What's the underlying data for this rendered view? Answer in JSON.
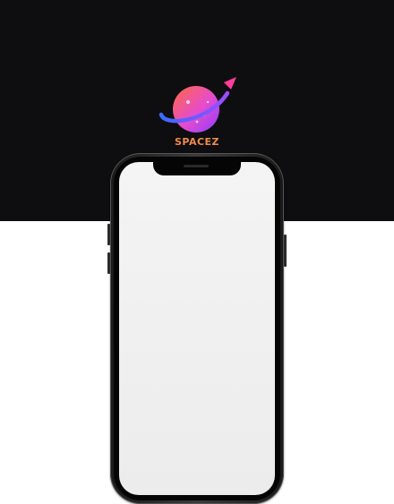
{
  "brand": {
    "name": "SPACEZ",
    "icon": "planet-rocket-logo-icon",
    "colors": {
      "planet_top": "#ff6a3d",
      "planet_bottom": "#c23bff",
      "ring": "#3a6bff",
      "rocket": "#ff3d9a",
      "text": "#f08a4b"
    }
  },
  "background": {
    "top_color": "#0e0d10",
    "bottom_color": "#ffffff"
  },
  "device": {
    "type": "smartphone-mockup",
    "screen_color": "#f0f0f0",
    "frame_color": "#1a1a1a"
  }
}
